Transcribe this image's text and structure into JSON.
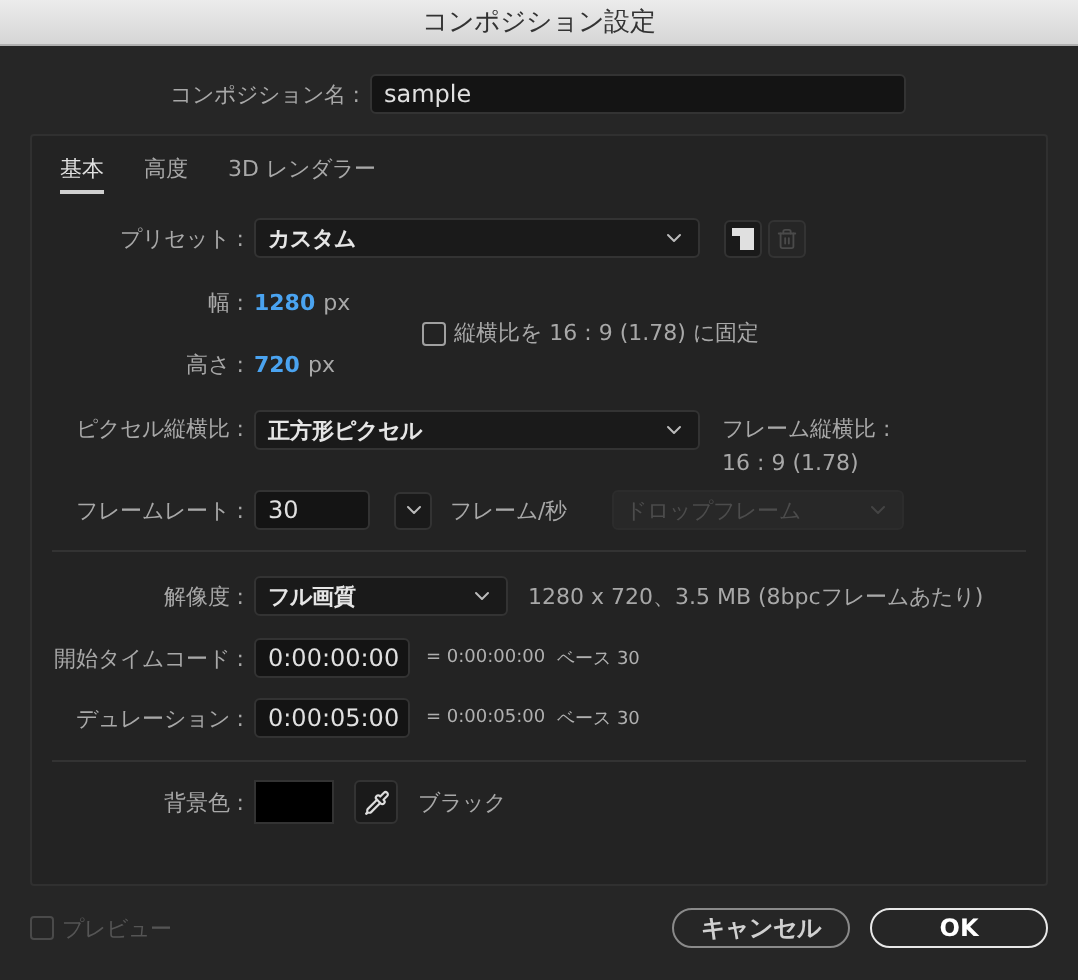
{
  "window": {
    "title": "コンポジション設定"
  },
  "composition_name": {
    "label": "コンポジション名 :",
    "value": "sample"
  },
  "tabs": [
    {
      "label": "基本",
      "selected": true
    },
    {
      "label": "高度",
      "selected": false
    },
    {
      "label": "3D レンダラー",
      "selected": false
    }
  ],
  "preset": {
    "label": "プリセット :",
    "value": "カスタム"
  },
  "width": {
    "label": "幅 :",
    "value": "1280",
    "unit": "px"
  },
  "height": {
    "label": "高さ :",
    "value": "720",
    "unit": "px"
  },
  "lock_aspect": {
    "label": "縦横比を 16 : 9 (1.78) に固定",
    "checked": false
  },
  "pixel_aspect": {
    "label": "ピクセル縦横比 :",
    "value": "正方形ピクセル"
  },
  "frame_aspect": {
    "label": "フレーム縦横比 :",
    "value": "16 : 9 (1.78)"
  },
  "frame_rate": {
    "label": "フレームレート :",
    "value": "30",
    "unit": "フレーム/秒"
  },
  "drop_frame": {
    "value": "ドロップフレーム",
    "disabled": true
  },
  "resolution": {
    "label": "解像度 :",
    "value": "フル画質",
    "info": "1280 x 720、3.5 MB (8bpcフレームあたり)"
  },
  "start_timecode": {
    "label": "開始タイムコード :",
    "value": "0:00:00:00",
    "equivalent": "= 0:00:00:00",
    "base": "ベース 30"
  },
  "duration": {
    "label": "デュレーション :",
    "value": "0:00:05:00",
    "equivalent": "= 0:00:05:00",
    "base": "ベース 30"
  },
  "background": {
    "label": "背景色 :",
    "color": "#000000",
    "name": "ブラック"
  },
  "preview": {
    "label": "プレビュー",
    "checked": false,
    "disabled": true
  },
  "buttons": [
    {
      "label": "キャンセル",
      "kind": "normal"
    },
    {
      "label": "OK",
      "kind": "default"
    }
  ]
}
